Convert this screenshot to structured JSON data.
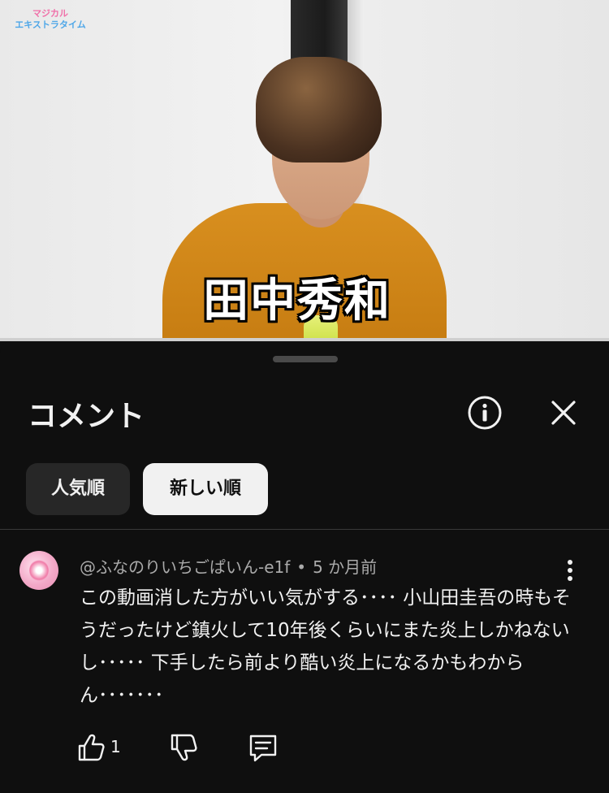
{
  "video": {
    "logo_line1": "マジカル",
    "logo_line2_a": "エキストラ",
    "logo_line2_b": "タイム",
    "caption": "田中秀和"
  },
  "comments_panel": {
    "title": "コメント",
    "sort_chips": [
      {
        "label": "人気順",
        "selected": false
      },
      {
        "label": "新しい順",
        "selected": true
      }
    ],
    "comment": {
      "author": "@ふなのりいちごぱいん-e1f",
      "separator": "•",
      "time": "5 か月前",
      "text": "この動画消した方がいい気がする････ 小山田圭吾の時もそうだったけど鎮火して10年後くらいにまた炎上しかねないし･････ 下手したら前より酷い炎上になるかもわからん･･･････",
      "like_count": "1"
    }
  },
  "icons": {
    "info": "info-icon",
    "close": "close-icon",
    "more": "more-vert-icon",
    "like": "thumb-up-icon",
    "dislike": "thumb-down-icon",
    "reply": "reply-comment-icon"
  },
  "colors": {
    "sheet_bg": "#0f0f0f",
    "chip_unselected": "#272727",
    "chip_selected": "#f1f1f1",
    "meta_text": "#aaaaaa"
  }
}
